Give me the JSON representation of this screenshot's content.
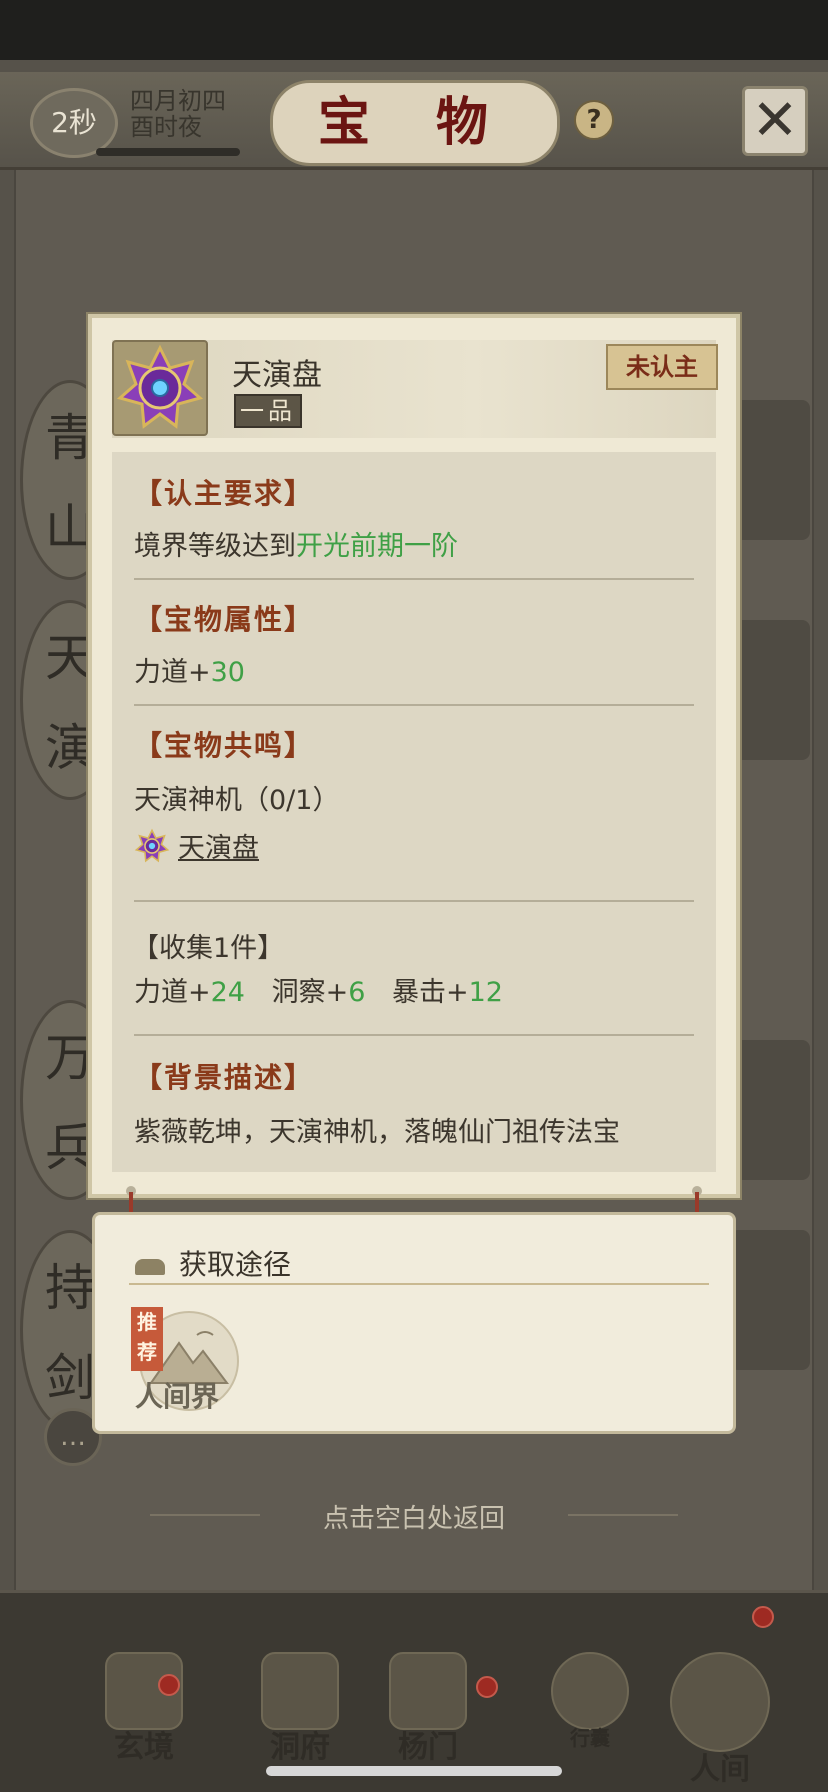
{
  "header": {
    "timer": "2秒",
    "date_line1": "四月初四",
    "date_line2": "酉时夜",
    "title": "宝 物",
    "help": "?",
    "close": "✕"
  },
  "side_labels": [
    "青山",
    "天演",
    "万兵",
    "持剑"
  ],
  "item": {
    "name": "天演盘",
    "grade": "一品",
    "status": "未认主",
    "icon": "purple-star-artifact-icon"
  },
  "sections": {
    "requirement": {
      "title": "【认主要求】",
      "prefix": "境界等级达到",
      "value": "开光前期一阶"
    },
    "attributes": {
      "title": "【宝物属性】",
      "stat": "力道+",
      "stat_value": "30"
    },
    "resonance": {
      "title": "【宝物共鸣】",
      "set_name": "天演神机（0/1）",
      "member": "天演盘",
      "collect_title": "【收集1件】",
      "bonuses": [
        {
          "label": "力道+",
          "value": "24"
        },
        {
          "label": "洞察+",
          "value": "6"
        },
        {
          "label": "暴击+",
          "value": "12"
        }
      ]
    },
    "background": {
      "title": "【背景描述】",
      "text": "紫薇乾坤，天演神机，落魄仙门祖传法宝"
    }
  },
  "obtain": {
    "title": "获取途径",
    "badge": "推荐",
    "source": "人间界"
  },
  "hint": "点击空白处返回",
  "nav": [
    {
      "label": "玄境",
      "badge": true
    },
    {
      "label": "洞府",
      "badge": false
    },
    {
      "label": "杨门",
      "badge": true
    },
    {
      "label": "行囊",
      "badge": false
    },
    {
      "label": "人间",
      "badge": true
    }
  ],
  "colors": {
    "accent_green": "#3fa046",
    "section_title": "#8a3a1a",
    "title_red": "#6b1512"
  }
}
